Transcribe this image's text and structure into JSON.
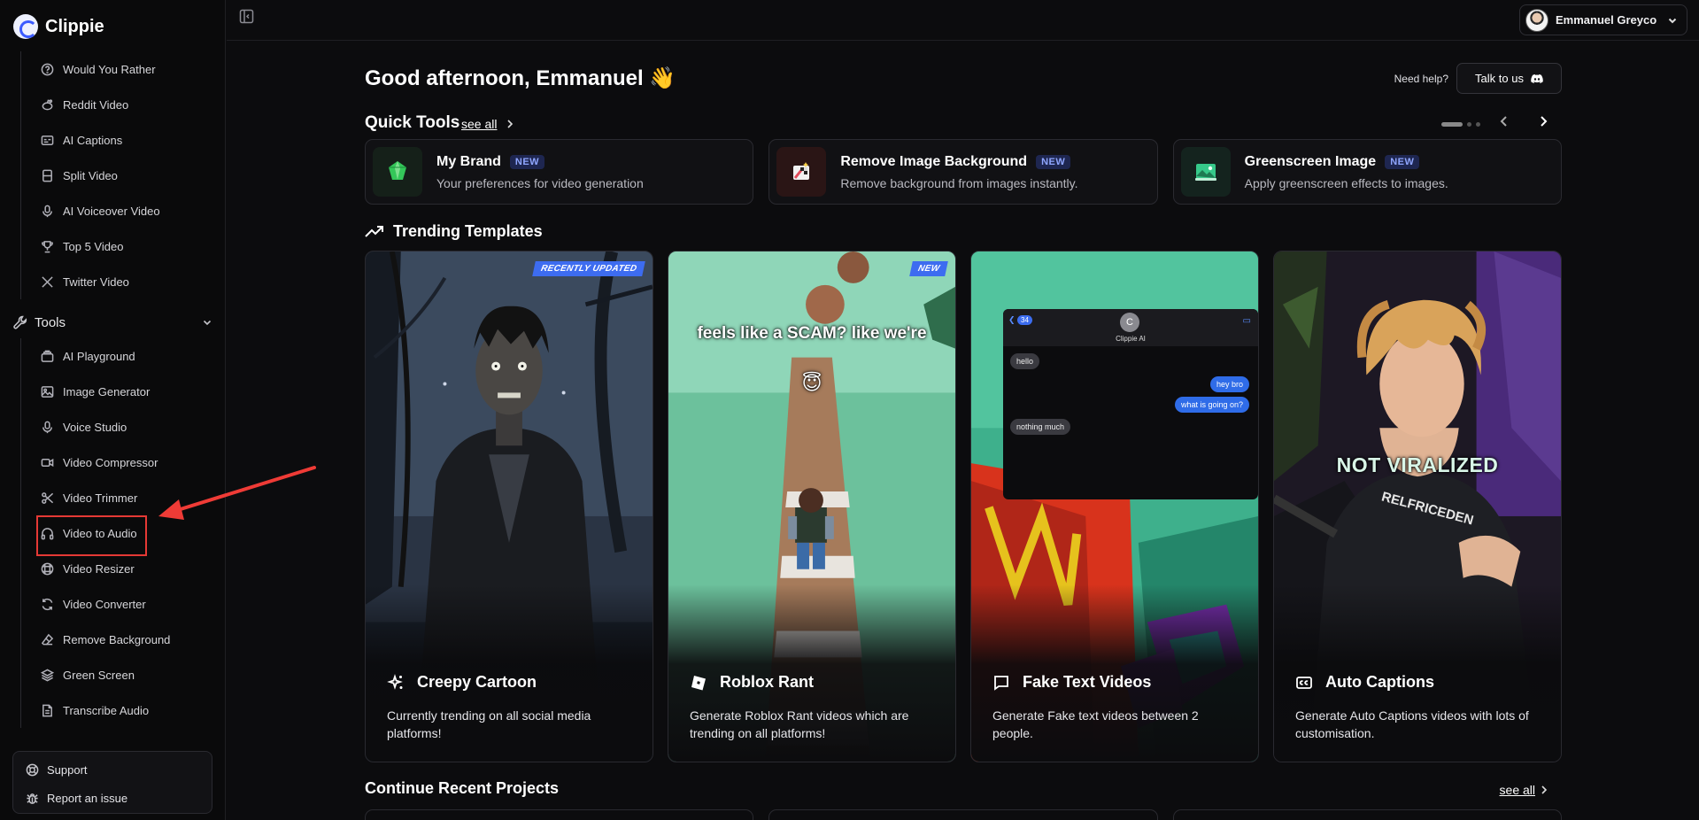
{
  "app": {
    "name": "Clippie"
  },
  "sidebar": {
    "items": [
      {
        "label": "Would You Rather",
        "icon": "question-circle-icon"
      },
      {
        "label": "Reddit Video",
        "icon": "reddit-icon"
      },
      {
        "label": "AI Captions",
        "icon": "captions-icon"
      },
      {
        "label": "Split Video",
        "icon": "split-screen-icon"
      },
      {
        "label": "AI Voiceover Video",
        "icon": "microphone-icon"
      },
      {
        "label": "Top 5 Video",
        "icon": "trophy-icon"
      },
      {
        "label": "Twitter Video",
        "icon": "x-logo-icon"
      }
    ],
    "tools_section": {
      "label": "Tools",
      "icon": "wrench-icon",
      "expanded": true
    },
    "tools": [
      {
        "label": "AI Playground",
        "icon": "playground-icon"
      },
      {
        "label": "Image Generator",
        "icon": "image-icon"
      },
      {
        "label": "Voice Studio",
        "icon": "microphone-icon"
      },
      {
        "label": "Video Compressor",
        "icon": "video-camera-icon"
      },
      {
        "label": "Video Trimmer",
        "icon": "scissors-icon"
      },
      {
        "label": "Video to Audio",
        "icon": "headphones-icon",
        "highlighted": true
      },
      {
        "label": "Video Resizer",
        "icon": "resize-icon"
      },
      {
        "label": "Video Converter",
        "icon": "refresh-icon"
      },
      {
        "label": "Remove Background",
        "icon": "eraser-icon"
      },
      {
        "label": "Green Screen",
        "icon": "layers-icon"
      },
      {
        "label": "Transcribe Audio",
        "icon": "document-icon"
      }
    ],
    "support": {
      "label": "Support",
      "icon": "lifebuoy-icon"
    },
    "report": {
      "label": "Report an issue",
      "icon": "bug-icon"
    }
  },
  "header": {
    "user_name": "Emmanuel Greyco"
  },
  "main": {
    "greeting": "Good afternoon, Emmanuel",
    "greeting_emoji": "👋",
    "need_help": "Need help?",
    "talk_button": "Talk to us",
    "quick_tools": {
      "title": "Quick Tools",
      "see_all": "see all",
      "cards": [
        {
          "name": "My Brand",
          "badge": "NEW",
          "description": "Your preferences for video generation",
          "icon": "brand-gem-icon"
        },
        {
          "name": "Remove Image Background",
          "badge": "NEW",
          "description": "Remove background from images instantly.",
          "icon": "magic-wand-icon"
        },
        {
          "name": "Greenscreen Image",
          "badge": "NEW",
          "description": "Apply greenscreen effects to images.",
          "icon": "greenscreen-image-icon"
        }
      ]
    },
    "trending": {
      "title": "Trending Templates",
      "templates": [
        {
          "name": "Creepy Cartoon",
          "badge": "RECENTLY UPDATED",
          "description": "Currently trending on all social media platforms!",
          "icon": "sparkles-icon"
        },
        {
          "name": "Roblox Rant",
          "badge": "NEW",
          "description": "Generate Roblox Rant videos which are trending on all platforms!",
          "icon": "roblox-icon",
          "overlay": "feels like a SCAM? like we're"
        },
        {
          "name": "Fake Text Videos",
          "badge": "",
          "description": "Generate Fake text videos between 2 people.",
          "icon": "message-icon",
          "chat": {
            "back_count": "34",
            "contact_initial": "C",
            "contact_name": "Clippie AI",
            "messages": [
              "hello",
              "hey bro",
              "what is going on?",
              "nothing much"
            ]
          }
        },
        {
          "name": "Auto Captions",
          "badge": "",
          "description": "Generate Auto Captions videos with lots of customisation.",
          "icon": "cc-icon",
          "overlay": "NOT VIRALIZED",
          "shirt_text": "RELFRICEDEN"
        }
      ]
    },
    "recent": {
      "title": "Continue Recent Projects",
      "see_all": "see all"
    }
  }
}
